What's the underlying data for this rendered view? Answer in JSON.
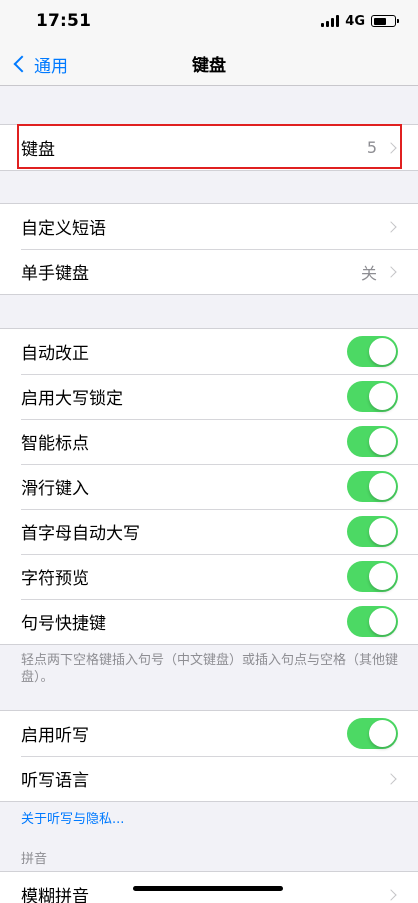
{
  "status_bar": {
    "time": "17:51",
    "network": "4G",
    "battery_level": 0.62
  },
  "nav": {
    "back_label": "通用",
    "title": "键盘"
  },
  "group_keyboards": {
    "items": [
      {
        "label": "键盘",
        "value": "5"
      }
    ]
  },
  "group_text": {
    "items": [
      {
        "label": "自定义短语",
        "value": ""
      },
      {
        "label": "单手键盘",
        "value": "关"
      }
    ]
  },
  "group_toggles": {
    "items": [
      {
        "label": "自动改正",
        "on": true
      },
      {
        "label": "启用大写锁定",
        "on": true
      },
      {
        "label": "智能标点",
        "on": true
      },
      {
        "label": "滑行键入",
        "on": true
      },
      {
        "label": "首字母自动大写",
        "on": true
      },
      {
        "label": "字符预览",
        "on": true
      },
      {
        "label": "句号快捷键",
        "on": true
      }
    ],
    "footnote": "轻点两下空格键插入句号（中文键盘）或插入句点与空格（其他键盘）。"
  },
  "group_dictation": {
    "items": [
      {
        "label": "启用听写",
        "on": true
      },
      {
        "label": "听写语言",
        "value": ""
      }
    ],
    "privacy_link": "关于听写与隐私..."
  },
  "pinyin": {
    "header": "拼音",
    "items": [
      {
        "label": "模糊拼音"
      }
    ]
  },
  "colors": {
    "accent": "#007aff",
    "toggle_on": "#4cd964",
    "highlight": "#e02020"
  }
}
